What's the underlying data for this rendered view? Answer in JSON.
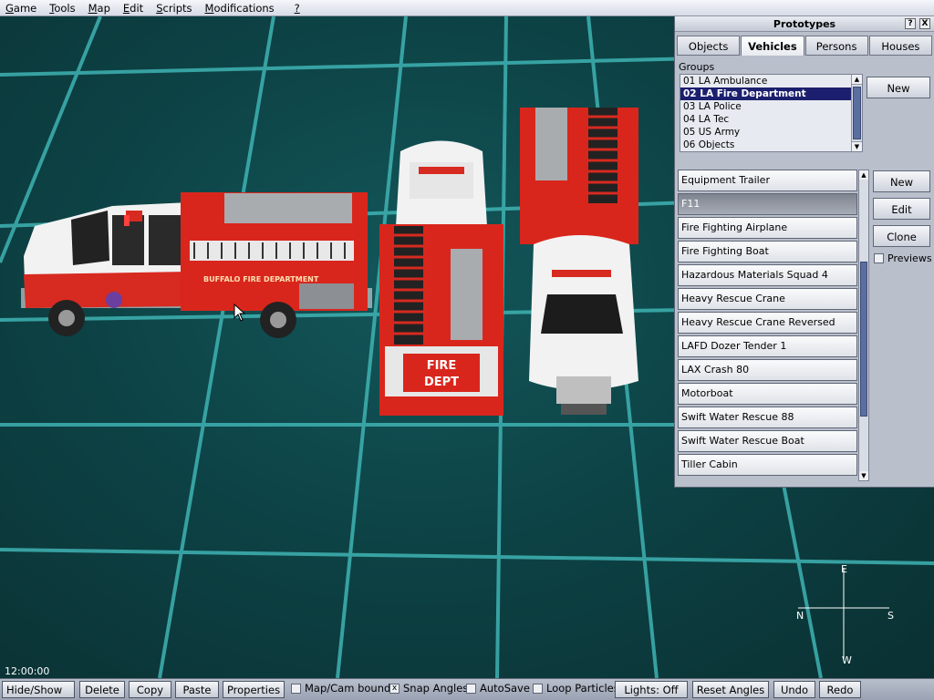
{
  "menu": [
    "Game",
    "Tools",
    "Map",
    "Edit",
    "Scripts",
    "Modifications",
    "?"
  ],
  "menu_underline": [
    "G",
    "T",
    "M",
    "E",
    "S",
    "M",
    "?"
  ],
  "menu_rest": [
    "ame",
    "ools",
    "ap",
    "dit",
    "cripts",
    "odifications",
    ""
  ],
  "scene": {
    "truck_text": "BUFFALO FIRE DEPARTMENT",
    "fire_text": "FIRE",
    "dept_text": "DEPT"
  },
  "panel": {
    "title": "Prototypes",
    "help_glyph": "?",
    "close_glyph": "X",
    "tabs": [
      {
        "label": "Objects",
        "active": false
      },
      {
        "label": "Vehicles",
        "active": true
      },
      {
        "label": "Persons",
        "active": false
      },
      {
        "label": "Houses",
        "active": false
      }
    ],
    "groups_label": "Groups",
    "groups": [
      {
        "label": "01 LA Ambulance",
        "selected": false
      },
      {
        "label": "02 LA Fire Department",
        "selected": true
      },
      {
        "label": "03 LA Police",
        "selected": false
      },
      {
        "label": "04 LA Tec",
        "selected": false
      },
      {
        "label": "05 US Army",
        "selected": false
      },
      {
        "label": "06 Objects",
        "selected": false
      }
    ],
    "groups_new": "New",
    "vehicles": [
      {
        "label": "Equipment Trailer",
        "selected": false
      },
      {
        "label": "F11",
        "selected": true
      },
      {
        "label": "Fire Fighting Airplane",
        "selected": false
      },
      {
        "label": "Fire Fighting Boat",
        "selected": false
      },
      {
        "label": "Hazardous Materials Squad 4",
        "selected": false
      },
      {
        "label": "Heavy Rescue Crane",
        "selected": false
      },
      {
        "label": "Heavy Rescue Crane Reversed",
        "selected": false
      },
      {
        "label": "LAFD Dozer Tender 1",
        "selected": false
      },
      {
        "label": "LAX Crash 80",
        "selected": false
      },
      {
        "label": "Motorboat",
        "selected": false
      },
      {
        "label": "Swift Water Rescue 88",
        "selected": false
      },
      {
        "label": "Swift Water Rescue Boat",
        "selected": false
      },
      {
        "label": "Tiller Cabin",
        "selected": false
      }
    ],
    "vehicle_buttons": {
      "new": "New",
      "edit": "Edit",
      "clone": "Clone"
    },
    "previews_label": "Previews",
    "previews_checked": false
  },
  "clock": "12:00:00",
  "compass": {
    "n": "N",
    "e": "E",
    "s": "S",
    "w": "W"
  },
  "toolbar": {
    "hide_show": "Hide/Show",
    "delete": "Delete",
    "copy": "Copy",
    "paste": "Paste",
    "properties": "Properties",
    "map_cam_bounds": "Map/Cam bounds",
    "snap_angles": "Snap Angles",
    "autosave": "AutoSave",
    "loop_particles": "Loop Particles",
    "lights": "Lights: Off",
    "reset_angles": "Reset Angles",
    "undo": "Undo",
    "redo": "Redo",
    "check_glyph": "x"
  },
  "colors": {
    "grid": "#3fb3b3",
    "fire_red": "#d9261c",
    "selection": "#1b1f6e"
  }
}
